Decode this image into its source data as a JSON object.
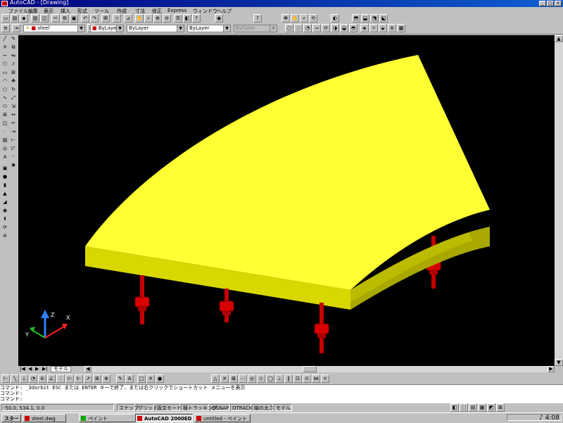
{
  "window": {
    "title": "AutoCAD - [Drawing]",
    "minimize": "_",
    "maximize": "□",
    "close": "×"
  },
  "menu": {
    "items": [
      "ファイル",
      "編集",
      "表示",
      "挿入",
      "形式",
      "ツール",
      "作成",
      "寸法",
      "修正",
      "Express",
      "ウィンドウ",
      "ヘルプ"
    ]
  },
  "properties": {
    "layer": "steel",
    "color": "ByLayer",
    "linetype": "ByLayer",
    "lineweight": "ByLayer",
    "plotstyle": "ByColor"
  },
  "layout_tabs": {
    "label": "モデル"
  },
  "command_window": {
    "lines": [
      "コマンド: _3dorbit ESC または ENTER キーで終了、または右クリックでショートカット メニューを表示",
      "コマンド:",
      "コマンド:"
    ]
  },
  "status_bar": {
    "coords": "-50.0, 534.1, 0.0",
    "toggles": [
      "スナップ",
      "グリッド",
      "直交モード",
      "極トラッキング",
      "OSNAP",
      "OTRACK",
      "線の太さ",
      "モデル"
    ]
  },
  "taskbar": {
    "start": "スタート",
    "tasks": [
      {
        "label": "steel.dwg",
        "active": false
      },
      {
        "label": "ペイント",
        "active": false
      },
      {
        "label": "AutoCAD 2000EDUC...",
        "active": true
      },
      {
        "label": "untitled - ペイント",
        "active": false
      }
    ],
    "clock": "4:08"
  },
  "colors": {
    "viewport": "#000000",
    "slab_top": "#ffff33",
    "slab_side": "#d8d800",
    "post": "#cc0000",
    "titlebar": "#00007c"
  }
}
